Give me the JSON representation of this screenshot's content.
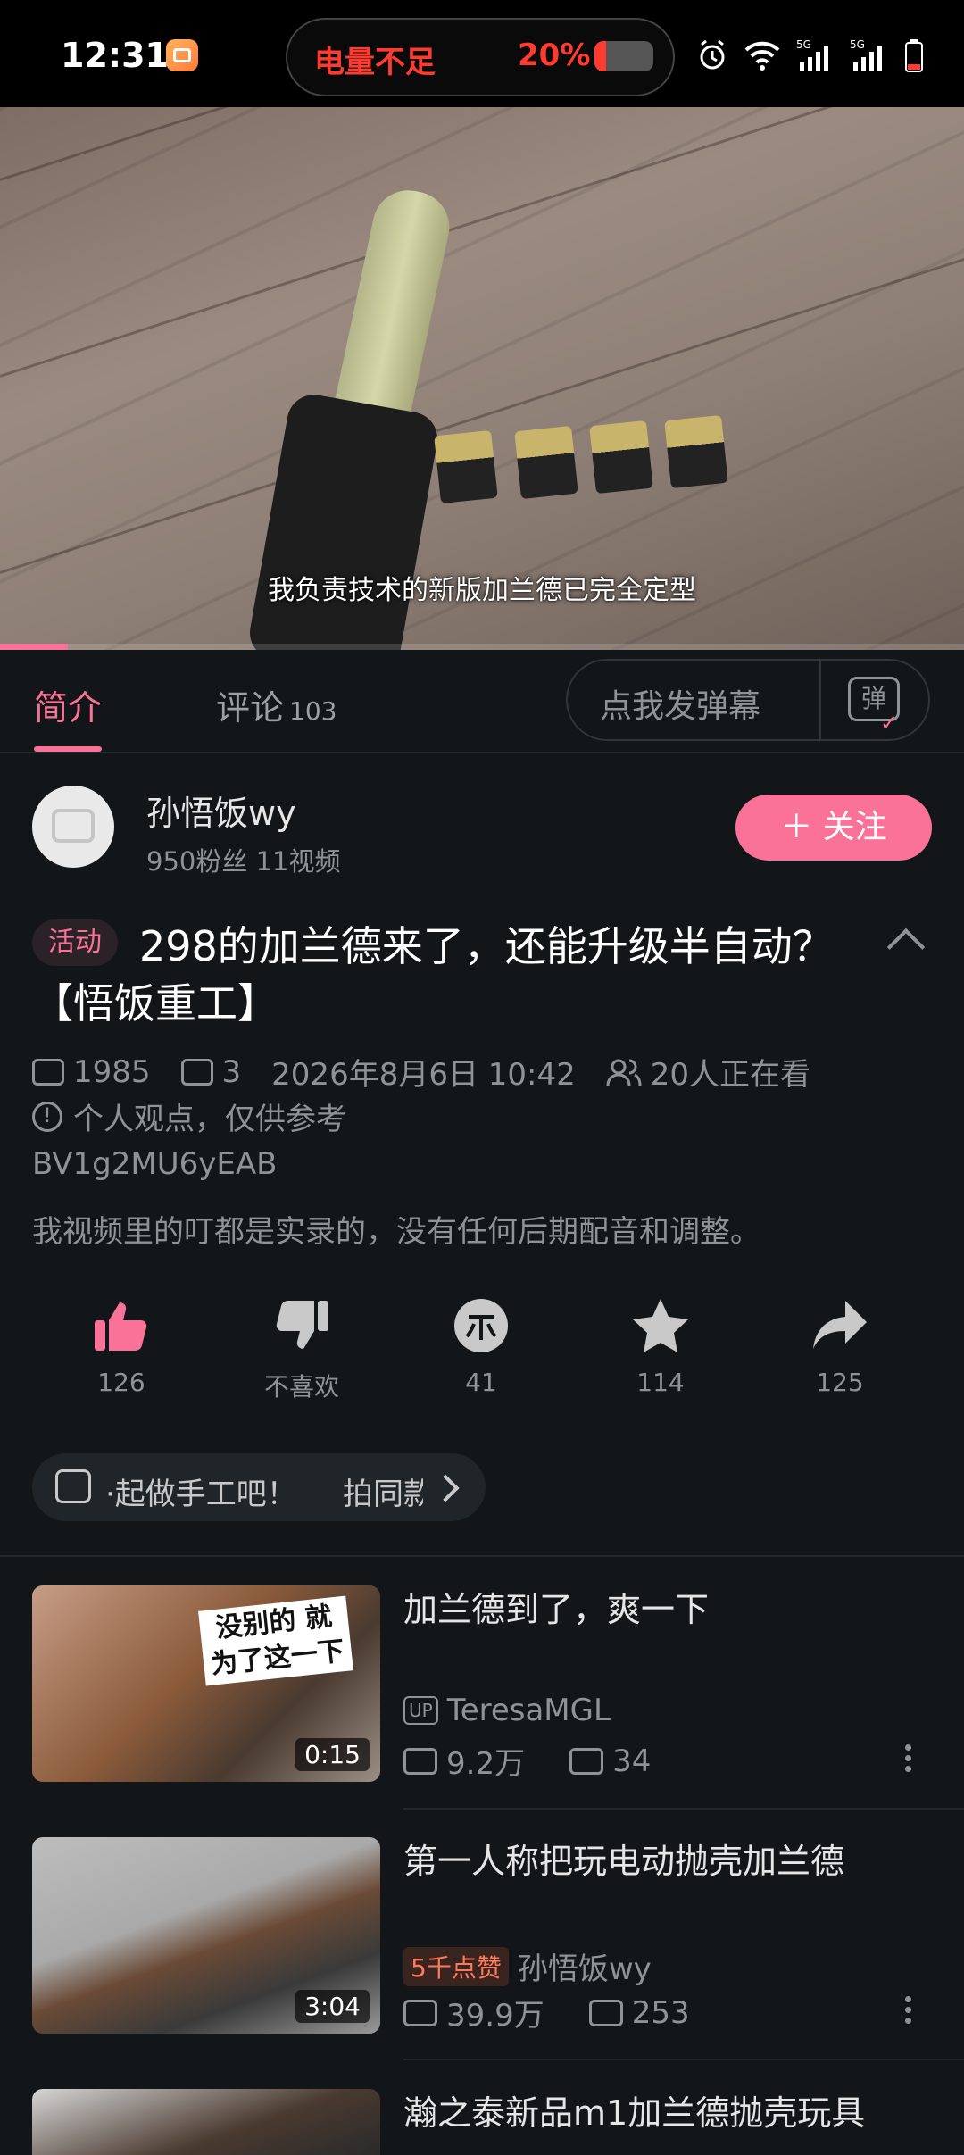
{
  "status_bar": {
    "time": "12:31",
    "battery_warning": "电量不足",
    "battery_percent": "20%",
    "battery_level": 0.2,
    "icons": [
      "alarm-icon",
      "wifi-icon",
      "5g-signal-icon",
      "5g-signal-icon",
      "battery-icon"
    ]
  },
  "video": {
    "subtitle": "我负责技术的新版加兰德已完全定型",
    "progress": 0.07
  },
  "tabs": {
    "intro": "简介",
    "comments": "评论",
    "comments_count": "103",
    "danmaku_placeholder": "点我发弹幕",
    "danmaku_icon_text": "弹"
  },
  "uploader": {
    "name": "孙悟饭wy",
    "stats": "950粉丝   11视频",
    "follow_label": "＋ 关注"
  },
  "video_info": {
    "tag": "活动",
    "title": "298的加兰德来了，还能升级半自动？【悟饭重工】",
    "plays": "1985",
    "danmaku_count": "3",
    "date": "2026年8月6日 10:42",
    "watching": "20人正在看",
    "note": "个人观点，仅供参考",
    "bvid": "BV1g2MU6yEAB",
    "description": "我视频里的叮都是实录的，没有任何后期配音和调整。"
  },
  "actions": [
    {
      "icon": "thumbs-up-icon",
      "label": "126",
      "color": "#fb7299"
    },
    {
      "icon": "thumbs-down-icon",
      "label": "不喜欢",
      "color": "#c9c9c9"
    },
    {
      "icon": "coin-icon",
      "label": "41",
      "color": "#c9c9c9"
    },
    {
      "icon": "star-icon",
      "label": "114",
      "color": "#c9c9c9"
    },
    {
      "icon": "share-icon",
      "label": "125",
      "color": "#c9c9c9"
    }
  ],
  "topic": {
    "text": "·起做手工吧！",
    "text2": "拍同款"
  },
  "recommendations": [
    {
      "title": "加兰德到了，爽一下",
      "duration": "0:15",
      "overlay": "没别的 就为了这一下",
      "up": "TeresaMGL",
      "badge": "",
      "plays": "9.2万",
      "danmaku": "34"
    },
    {
      "title": "第一人称把玩电动抛壳加兰德",
      "duration": "3:04",
      "overlay": "",
      "up": "孙悟饭wy",
      "badge": "5千点赞",
      "plays": "39.9万",
      "danmaku": "253"
    },
    {
      "title": "瀚之泰新品m1加兰德抛壳玩具",
      "duration": "",
      "overlay": "",
      "up": "",
      "badge": "",
      "plays": "",
      "danmaku": ""
    }
  ],
  "colors": {
    "accent": "#fb7299",
    "background": "#121618",
    "warning": "#ff3b30"
  }
}
